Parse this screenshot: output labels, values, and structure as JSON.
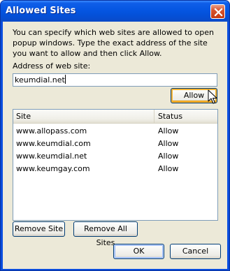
{
  "window": {
    "title": "Allowed Sites"
  },
  "dialog": {
    "description": "You can specify which web sites are allowed to open popup windows. Type the exact address of the site you want to allow and then click Allow.",
    "address_label": "Address of web site:",
    "address_value": "keumdial.net",
    "allow_label": "Allow",
    "list": {
      "columns": [
        "Site",
        "Status"
      ],
      "rows": [
        {
          "site": "www.allopass.com",
          "status": "Allow"
        },
        {
          "site": "www.keumdial.com",
          "status": "Allow"
        },
        {
          "site": "www.keumdial.net",
          "status": "Allow"
        },
        {
          "site": "www.keumgay.com",
          "status": "Allow"
        }
      ]
    },
    "remove_site_label": "Remove Site",
    "remove_all_label": "Remove All Sites",
    "ok_label": "OK",
    "cancel_label": "Cancel"
  },
  "icons": {
    "close": "close-icon",
    "cursor": "mouse-pointer-icon"
  },
  "colors": {
    "titlebar": "#0556e2",
    "dialog_bg": "#ece9d8",
    "close_button": "#d8542e",
    "hover_highlight": "#f8b331",
    "input_border": "#7f9db9"
  }
}
